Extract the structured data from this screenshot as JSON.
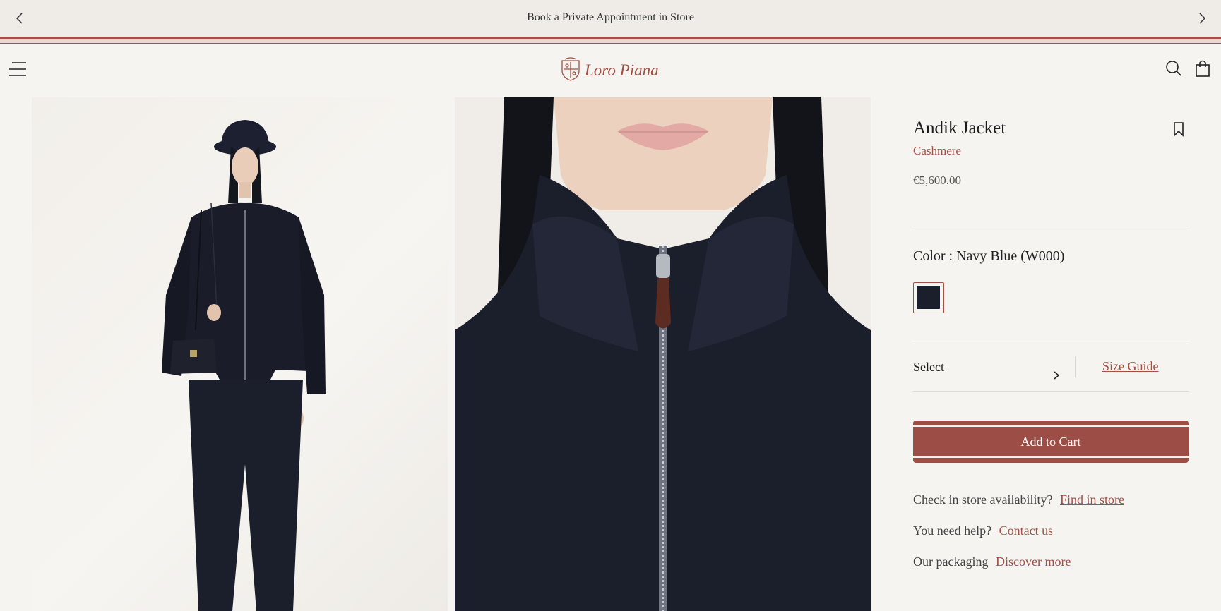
{
  "promo": {
    "text": "Book a Private Appointment in Store",
    "prev_icon": "chevron-left-icon",
    "next_icon": "chevron-right-icon"
  },
  "header": {
    "logo_text": "Loro Piana",
    "menu_icon": "menu-icon",
    "search_icon": "search-icon",
    "bag_icon": "shopping-bag-icon"
  },
  "gallery": {
    "images": [
      {
        "alt": "Model wearing Andik Jacket, full length"
      },
      {
        "alt": "Close-up of Andik Jacket collar and zipper"
      }
    ]
  },
  "product": {
    "name": "Andik Jacket",
    "material": "Cashmere",
    "price": "€5,600.00",
    "bookmark_icon": "bookmark-icon",
    "color_label": "Color : Navy Blue (W000)",
    "swatch_color": "#1b1f2c",
    "size_select_label": "Select",
    "size_guide_label": "Size Guide",
    "add_to_cart_label": "Add to Cart"
  },
  "info": [
    {
      "text": "Check in store availability?",
      "link": "Find in store"
    },
    {
      "text": "You need help?",
      "link": "Contact us"
    },
    {
      "text": "Our packaging",
      "link": "Discover more"
    }
  ],
  "colors": {
    "accent": "#a24f45",
    "background": "#f6f4f0",
    "promo_background": "#efece7"
  }
}
